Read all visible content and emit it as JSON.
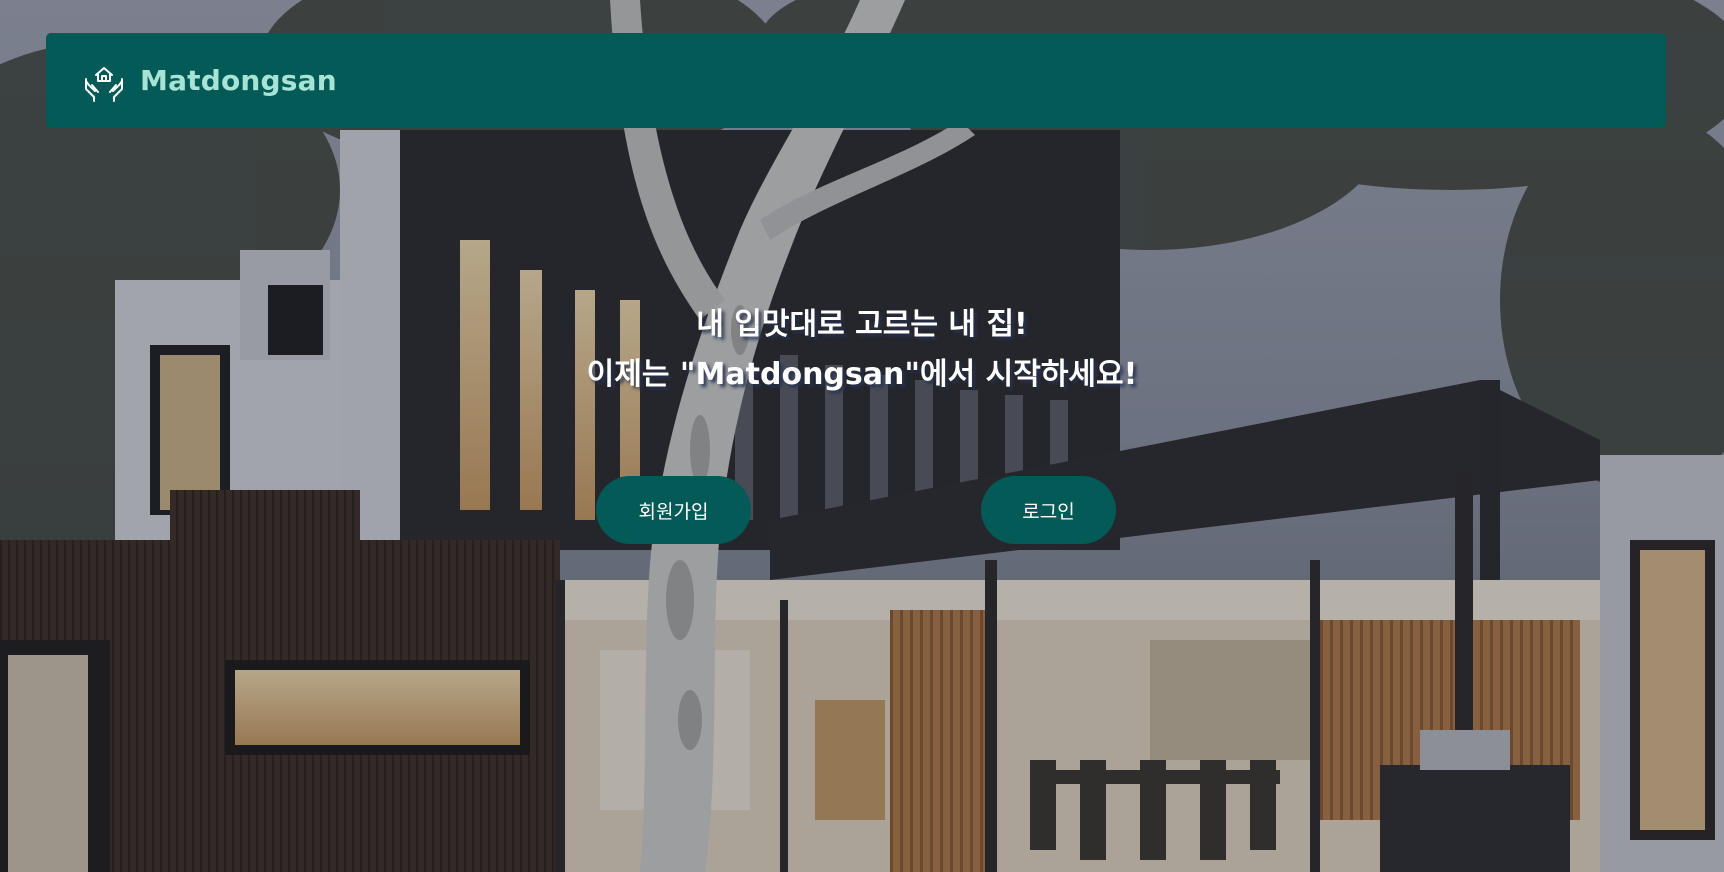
{
  "brand": {
    "name": "Matdongsan",
    "icon": "house-in-hands-icon",
    "color": "#a8e4d6"
  },
  "hero": {
    "line1": "내 입맛대로 고르는 내 집!",
    "line2": "이제는 \"Matdongsan\"에서 시작하세요!"
  },
  "buttons": {
    "signup": "회원가입",
    "login": "로그인"
  },
  "colors": {
    "primary": "#035a56",
    "text": "#ffffff"
  },
  "background": {
    "image": "modern-house-at-dusk"
  }
}
